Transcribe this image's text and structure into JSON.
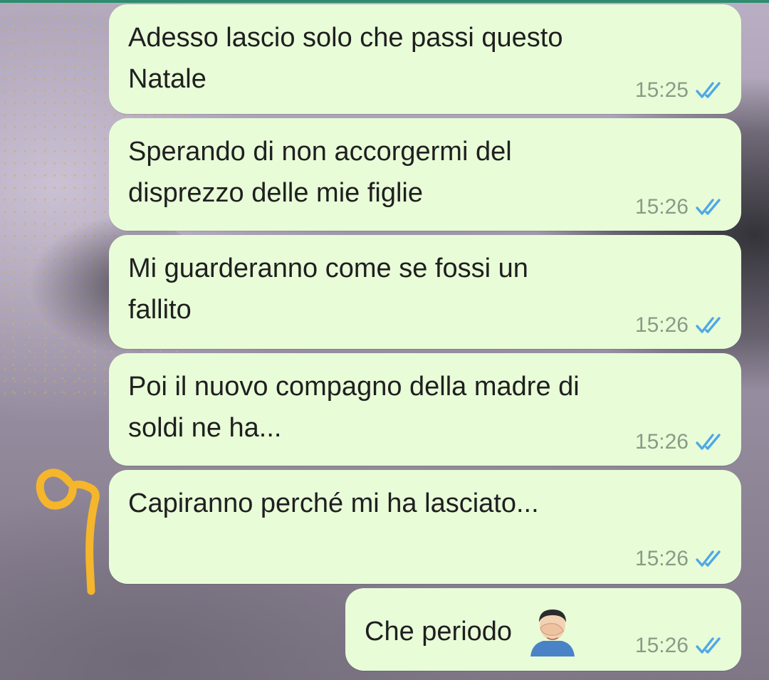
{
  "conversation": {
    "messages": [
      {
        "text": "Adesso lascio solo che passi questo\nNatale",
        "time": "15:25",
        "status": "read"
      },
      {
        "text": "Sperando di non accorgermi del\ndisprezzo delle mie figlie",
        "time": "15:26",
        "status": "read"
      },
      {
        "text": "Mi guarderanno come se fossi un\nfallito",
        "time": "15:26",
        "status": "read"
      },
      {
        "text": "Poi il nuovo compagno della madre di\nsoldi ne ha...",
        "time": "15:26",
        "status": "read"
      },
      {
        "text": "Capiranno perché mi ha lasciato...",
        "time": "15:26",
        "status": "read"
      },
      {
        "text": "Che periodo",
        "time": "15:26",
        "status": "read",
        "emoji": "man-facepalming-icon"
      }
    ]
  },
  "theme": {
    "outgoing_bubble": "#e8fcd8",
    "read_check": "#4fa8e6",
    "time_color": "#8c9a86",
    "header_line": "#2e8c6f",
    "annotation_color": "#f5b62c"
  }
}
